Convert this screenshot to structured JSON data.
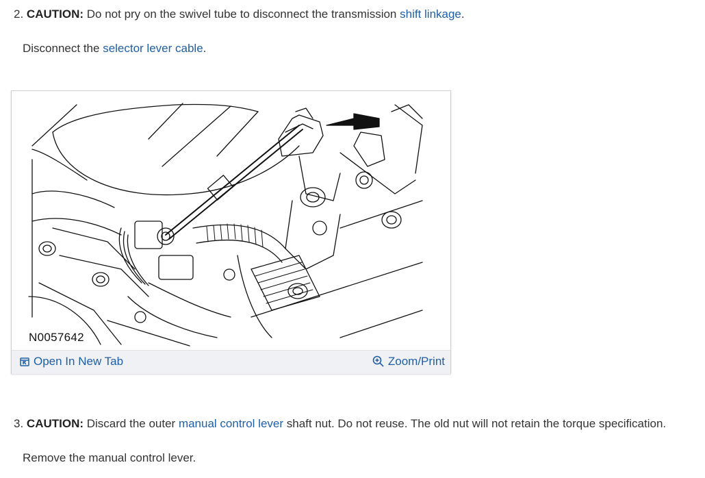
{
  "steps": [
    {
      "number": "2.",
      "caution_label": "CAUTION:",
      "text_before_link": " Do not pry on the swivel tube to disconnect the transmission ",
      "link": "shift linkage",
      "text_after_link": ".",
      "sub_before": "Disconnect the ",
      "sub_link": "selector lever cable",
      "sub_after": "."
    },
    {
      "number": "3.",
      "caution_label": "CAUTION:",
      "text_before_link": " Discard the outer ",
      "link": "manual control lever",
      "text_after_link": " shaft nut. Do not reuse. The old nut will not retain the torque specification.",
      "sub_text": "Remove the manual control lever."
    }
  ],
  "figure": {
    "id": "N0057642",
    "open_label": "Open In New Tab",
    "zoom_label": "Zoom/Print",
    "open_icon": "open-in-new-tab-icon",
    "zoom_icon": "zoom-in-icon"
  },
  "colors": {
    "link": "#1f5fa8",
    "text": "#333333",
    "bar_bg": "#f0f1f4"
  }
}
